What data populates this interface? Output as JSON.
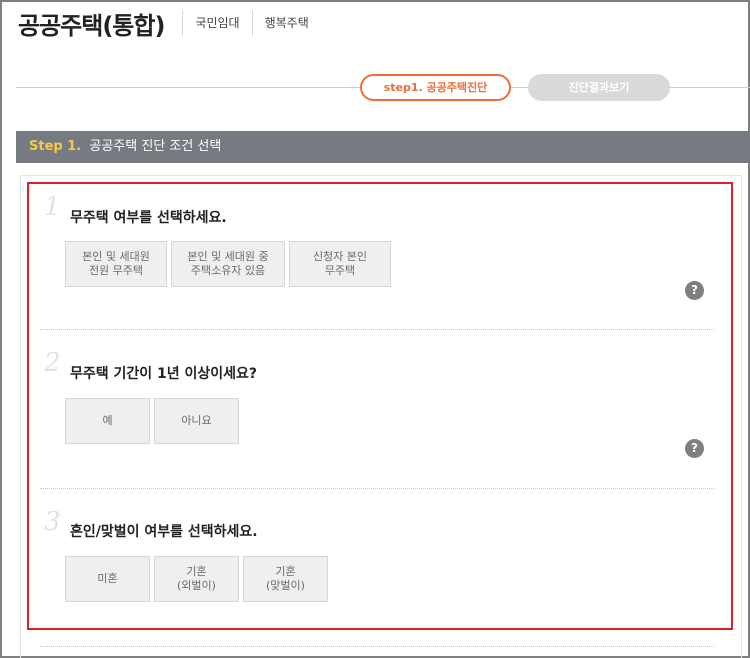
{
  "header": {
    "title": "공공주택(통합)",
    "nav": [
      "국민임대",
      "행복주택"
    ]
  },
  "steps": {
    "active": "step1. 공공주택진단",
    "inactive": "진단결과보기"
  },
  "section": {
    "step_label": "Step 1.",
    "title": "공공주택 진단 조건 선택"
  },
  "questions": [
    {
      "number": "1",
      "text": "무주택 여부를 선택하세요.",
      "options": [
        {
          "line1": "본인 및 세대원",
          "line2": "전원 무주택"
        },
        {
          "line1": "본인 및 세대원 중",
          "line2": "주택소유자 있음"
        },
        {
          "line1": "신청자 본인",
          "line2": "무주택"
        }
      ],
      "help": "?"
    },
    {
      "number": "2",
      "text": "무주택 기간이 1년 이상이세요?",
      "options": [
        {
          "line1": "예",
          "line2": ""
        },
        {
          "line1": "아니요",
          "line2": ""
        }
      ],
      "help": "?"
    },
    {
      "number": "3",
      "text": "혼인/맞벌이 여부를 선택하세요.",
      "options": [
        {
          "line1": "미혼",
          "line2": ""
        },
        {
          "line1": "기혼",
          "line2": "(외벌이)"
        },
        {
          "line1": "기혼",
          "line2": "(맞벌이)"
        }
      ]
    }
  ],
  "colors": {
    "accent": "#e8703a",
    "section_bar": "#767b82",
    "highlight_border": "#e01e2a",
    "step_number": "#f7c948"
  }
}
